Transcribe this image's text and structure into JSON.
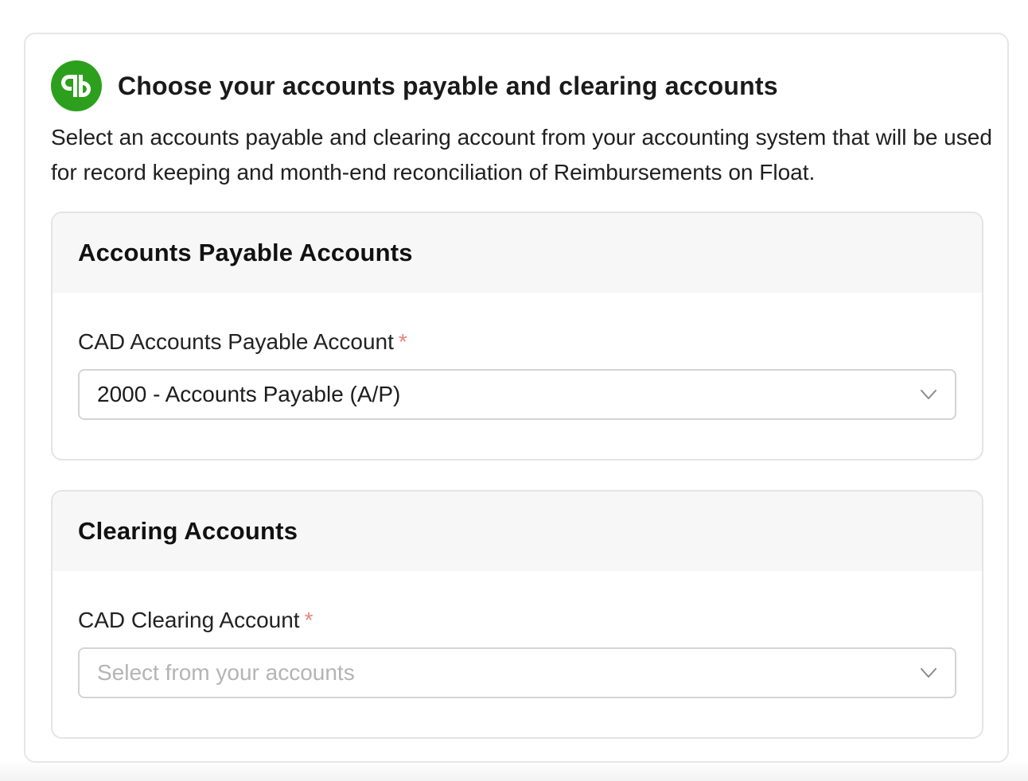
{
  "app": {
    "logo_icon": "quickbooks-logo-icon",
    "brand_color": "#2ca01c"
  },
  "card": {
    "title": "Choose your accounts payable and clearing accounts",
    "description": "Select an accounts payable and clearing account from your accounting system that will be used for record keeping and month-end reconciliation of Reimbursements on Float."
  },
  "sections": {
    "payable": {
      "title": "Accounts Payable Accounts",
      "field_label": "CAD Accounts Payable Account",
      "required_mark": "*",
      "selected_value": "2000 - Accounts Payable (A/P)",
      "chevron_icon": "chevron-down-icon"
    },
    "clearing": {
      "title": "Clearing Accounts",
      "field_label": "CAD Clearing Account",
      "required_mark": "*",
      "placeholder": "Select from your accounts",
      "chevron_icon": "chevron-down-icon"
    }
  },
  "colors": {
    "required": "#e8837d",
    "placeholder": "#b4b4b4",
    "section_header_bg": "#f7f7f7"
  }
}
